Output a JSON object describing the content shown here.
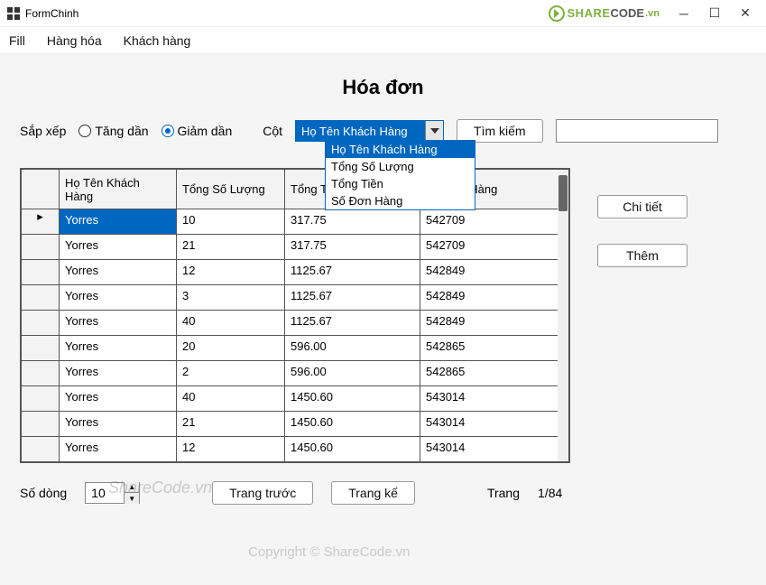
{
  "window": {
    "title": "FormChinh"
  },
  "brand": {
    "share": "SHARE",
    "code": "CODE",
    "vn": ".vn"
  },
  "menu": {
    "fill": "Fill",
    "hanghoa": "Hàng hóa",
    "khachhang": "Khách hàng"
  },
  "page": {
    "heading": "Hóa đơn"
  },
  "filter": {
    "sort_label": "Sắp xếp",
    "asc_label": "Tăng dần",
    "desc_label": "Giảm dần",
    "column_label": "Cột",
    "selected": "Họ Tên Khách Hàng",
    "options": [
      "Họ Tên Khách Hàng",
      "Tổng Số Lượng",
      "Tổng Tiền",
      "Số Đơn Hàng"
    ],
    "search_btn": "Tìm kiếm",
    "search_value": ""
  },
  "sidebuttons": {
    "detail": "Chi tiết",
    "add": "Thêm"
  },
  "grid": {
    "headers": {
      "name": "Họ Tên Khách Hàng",
      "qty": "Tổng Số Lượng",
      "total": "Tổng Tiền",
      "order": "Số Đơn Hàng"
    },
    "rows": [
      {
        "name": "Yorres",
        "qty": "10",
        "total": "317.75",
        "order": "542709"
      },
      {
        "name": "Yorres",
        "qty": "21",
        "total": "317.75",
        "order": "542709"
      },
      {
        "name": "Yorres",
        "qty": "12",
        "total": "1125.67",
        "order": "542849"
      },
      {
        "name": "Yorres",
        "qty": "3",
        "total": "1125.67",
        "order": "542849"
      },
      {
        "name": "Yorres",
        "qty": "40",
        "total": "1125.67",
        "order": "542849"
      },
      {
        "name": "Yorres",
        "qty": "20",
        "total": "596.00",
        "order": "542865"
      },
      {
        "name": "Yorres",
        "qty": "2",
        "total": "596.00",
        "order": "542865"
      },
      {
        "name": "Yorres",
        "qty": "40",
        "total": "1450.60",
        "order": "543014"
      },
      {
        "name": "Yorres",
        "qty": "21",
        "total": "1450.60",
        "order": "543014"
      },
      {
        "name": "Yorres",
        "qty": "12",
        "total": "1450.60",
        "order": "543014"
      }
    ]
  },
  "pager": {
    "rows_label": "Số dòng",
    "rows_value": "10",
    "prev": "Trang trước",
    "next": "Trang kế",
    "page_label": "Trang",
    "page_value": "1/84"
  },
  "watermarks": {
    "w1": "ShareCode.vn",
    "w2": "Copyright © ShareCode.vn"
  }
}
